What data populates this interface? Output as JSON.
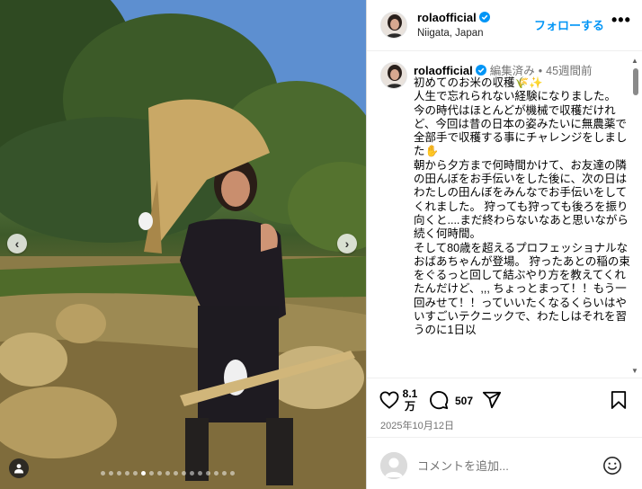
{
  "post": {
    "username": "rolaofficial",
    "location": "Niigata, Japan",
    "follow_label": "フォローする",
    "more_label": "•••",
    "edited_label": "編集済み",
    "separator": "•",
    "time_ago": "45週間前",
    "caption": "初めてのお米の収穫🌾✨\n人生で忘れられない経験になりました。\n今の時代はほとんどが機械で収穫だけれど、今回は昔の日本の姿みたいに無農薬で全部手で収穫する事にチャレンジをしました✋\n朝から夕方まで何時間かけて、お友達の隣の田んぼをお手伝いをした後に、次の日はわたしの田んぼをみんなでお手伝いをしてくれました。 狩っても狩っても後ろを振り向くと....まだ終わらないなあと思いながら続く何時間。\nそして80歳を超えるプロフェッショナルなおばあちゃんが登場。 狩ったあとの稲の束をぐるっと回して結ぶやり方を教えてくれたんだけど、,,, ちょっとまって！！もう一回みせて！！っていいたくなるくらいはやいすごいテクニックで、わたしはそれを習うのに1日以"
  },
  "actions": {
    "likes": "8.1\n万",
    "comments": "507",
    "date": "2025年10月12日"
  },
  "comment_box": {
    "placeholder": "コメントを追加..."
  },
  "media": {
    "carousel_total": 17,
    "carousel_active": 5
  },
  "colors": {
    "accent": "#0095f6",
    "verified": "#0095f6",
    "muted": "#737373"
  },
  "icons": [
    "chevron-left-icon",
    "chevron-right-icon",
    "user-tag-icon",
    "verified-badge-icon",
    "heart-icon",
    "comment-icon",
    "share-icon",
    "bookmark-icon",
    "emoji-icon"
  ]
}
